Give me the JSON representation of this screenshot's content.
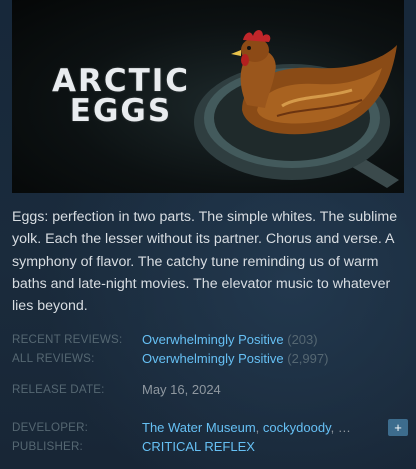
{
  "capsule": {
    "title": "ARCTIC\nEGGS"
  },
  "description": "Eggs: perfection in two parts. The simple whites. The sublime yolk. Each the lesser without its partner. Chorus and verse. A symphony of flavor. The catchy tune reminding us of warm baths and late-night movies. The elevator music to whatever lies beyond.",
  "reviews": {
    "recent_label": "RECENT REVIEWS:",
    "recent_summary": "Overwhelmingly Positive",
    "recent_count": "(203)",
    "all_label": "ALL REVIEWS:",
    "all_summary": "Overwhelmingly Positive",
    "all_count": "(2,997)"
  },
  "release": {
    "label": "RELEASE DATE:",
    "date": "May 16, 2024"
  },
  "developer": {
    "label": "DEVELOPER:",
    "names": [
      "The Water Museum",
      "cockydoody"
    ],
    "separator": ",",
    "more": "…",
    "plus_label": "+"
  },
  "publisher": {
    "label": "PUBLISHER:",
    "name": "CRITICAL REFLEX"
  },
  "colors": {
    "background": "#1b2838",
    "link": "#66c0f4",
    "label": "#556772",
    "text": "#d8dde2",
    "plus_button": "#3d6c8d"
  }
}
